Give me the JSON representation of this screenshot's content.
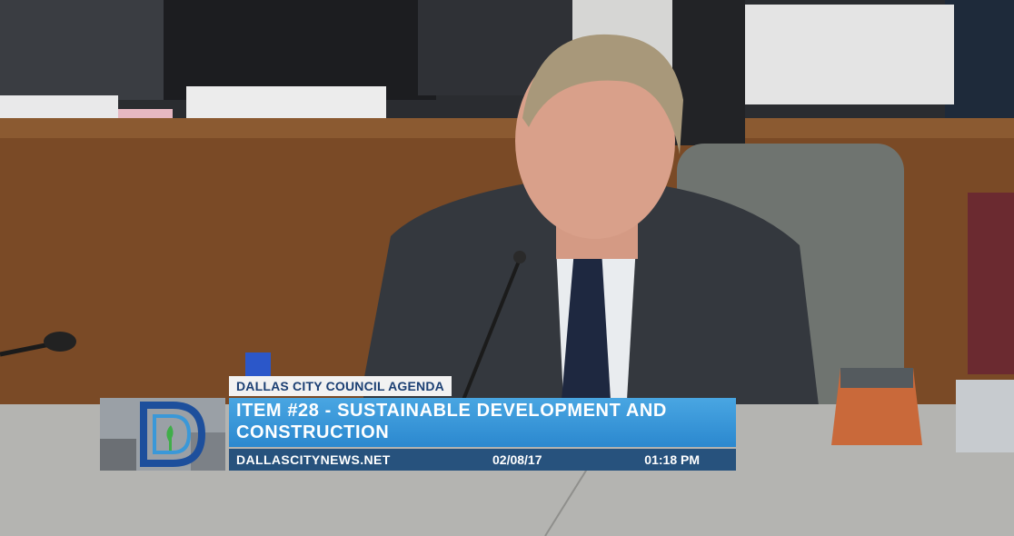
{
  "lower_third": {
    "header": "DALLAS CITY COUNCIL AGENDA",
    "title": "ITEM #28 - SUSTAINABLE DEVELOPMENT AND CONSTRUCTION",
    "website": "DALLASCITYNEWS.NET",
    "date": "02/08/17",
    "time": "01:18 PM"
  },
  "colors": {
    "banner_blue": "#3a98d8",
    "footer_navy": "#27527d",
    "header_text": "#1b3f73"
  }
}
